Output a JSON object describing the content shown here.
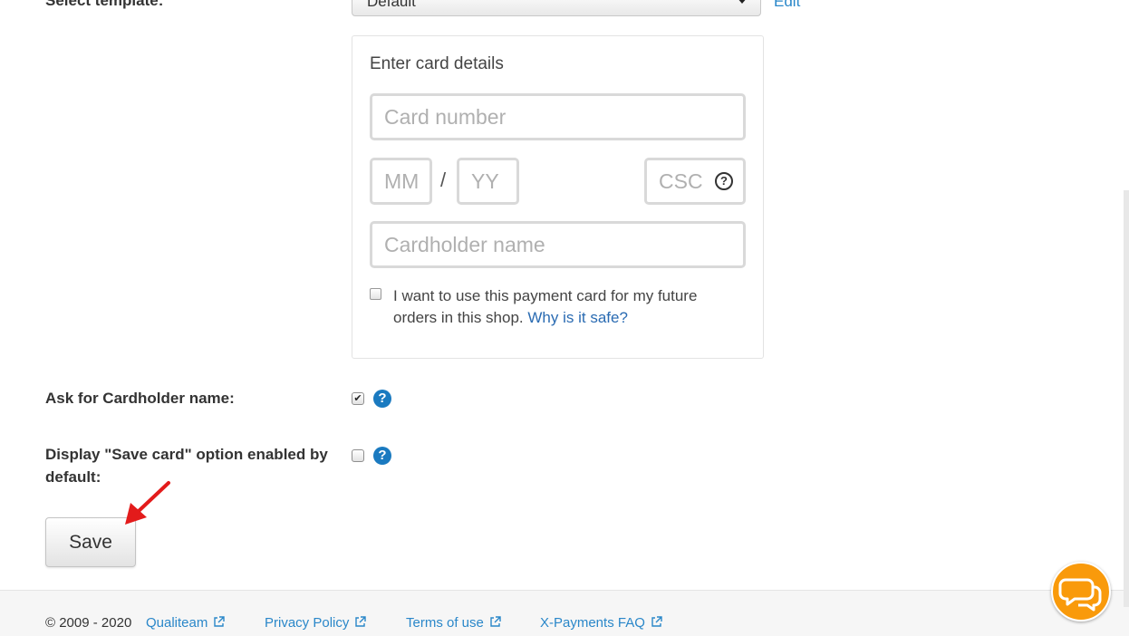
{
  "form": {
    "select_template_label": "Select template:",
    "template_value": "Default",
    "edit_link": "Edit",
    "ask_cardholder_label": "Ask for Cardholder name:",
    "ask_cardholder_checked": true,
    "save_card_label": "Display \"Save card\" option enabled by default:",
    "save_card_checked": false,
    "help_glyph": "?",
    "save_button": "Save"
  },
  "card": {
    "title": "Enter card details",
    "number_placeholder": "Card number",
    "month_placeholder": "MM",
    "slash": "/",
    "year_placeholder": "YY",
    "csc_placeholder": "CSC",
    "holder_placeholder": "Cardholder name",
    "save_card_text": "I want to use this payment card for my future orders in this shop.",
    "why_safe_link": "Why is it safe?"
  },
  "footer": {
    "copyright": "© 2009 - 2020",
    "links": [
      "Qualiteam",
      "Privacy Policy",
      "Terms of use",
      "X-Payments FAQ"
    ]
  },
  "colors": {
    "link": "#2a87c9",
    "help_icon": "#1a7ac0",
    "chat_button": "#f99a0b",
    "annotation_arrow": "#e31b1b"
  },
  "icons": [
    "chevron-down-icon",
    "question-circle-icon",
    "help-icon",
    "external-link-icon",
    "chat-bubbles-icon",
    "red-arrow-annotation"
  ]
}
